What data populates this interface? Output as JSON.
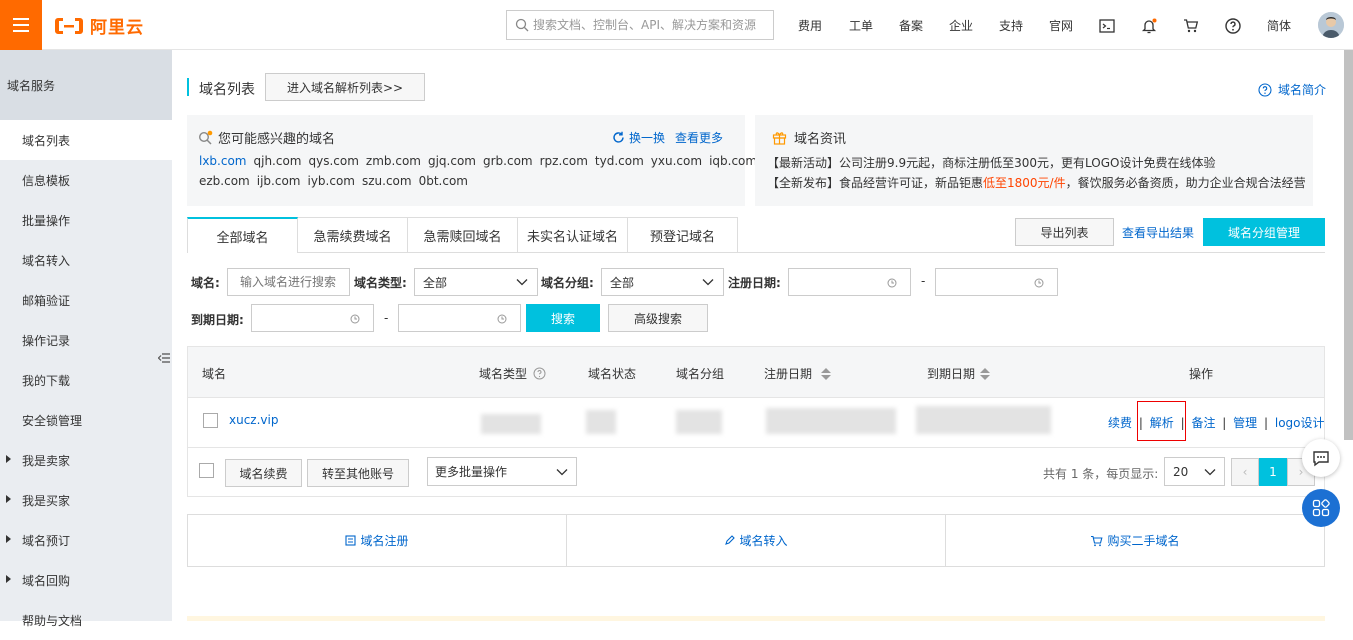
{
  "topbar": {
    "logo_text": "阿里云",
    "search_placeholder": "搜索文档、控制台、API、解决方案和资源",
    "nav": [
      "费用",
      "工单",
      "备案",
      "企业",
      "支持",
      "官网"
    ],
    "lang": "简体"
  },
  "sidebar": {
    "title": "域名服务",
    "items": [
      {
        "label": "域名列表"
      },
      {
        "label": "信息模板"
      },
      {
        "label": "批量操作"
      },
      {
        "label": "域名转入"
      },
      {
        "label": "邮箱验证"
      },
      {
        "label": "操作记录"
      },
      {
        "label": "我的下载"
      },
      {
        "label": "安全锁管理"
      },
      {
        "label": "我是卖家"
      },
      {
        "label": "我是买家"
      },
      {
        "label": "域名预订"
      },
      {
        "label": "域名回购"
      },
      {
        "label": "帮助与文档"
      }
    ]
  },
  "header": {
    "title": "域名列表",
    "enter_parse_list": "进入域名解析列表>>",
    "intro_link": "域名简介"
  },
  "interest": {
    "title": "您可能感兴趣的域名",
    "refresh": "换一换",
    "more": "查看更多",
    "row1": [
      "lxb.com",
      "qjh.com",
      "qys.com",
      "zmb.com",
      "gjq.com",
      "grb.com",
      "rpz.com",
      "tyd.com",
      "yxu.com",
      "iqb.com"
    ],
    "row2": [
      "ezb.com",
      "ijb.com",
      "iyb.com",
      "szu.com",
      "0bt.com"
    ]
  },
  "news": {
    "title": "域名资讯",
    "line1": "【最新活动】公司注册9.9元起，商标注册低至300元，更有LOGO设计免费在线体验",
    "line2_a": "【全新发布】食品经营许可证，新品钜惠",
    "line2_highlight": "低至1800元/件",
    "line2_b": "，餐饮服务必备资质，助力企业合规合法经营"
  },
  "tabs": [
    "全部域名",
    "急需续费域名",
    "急需赎回域名",
    "未实名认证域名",
    "预登记域名"
  ],
  "actions": {
    "export_list": "导出列表",
    "view_export": "查看导出结果",
    "group_manage": "域名分组管理"
  },
  "filters": {
    "domain_label": "域名:",
    "domain_placeholder": "输入域名进行搜索",
    "type_label": "域名类型:",
    "type_value": "全部",
    "group_label": "域名分组:",
    "group_value": "全部",
    "reg_date_label": "注册日期:",
    "expire_date_label": "到期日期:",
    "dash": "-",
    "search_btn": "搜索",
    "advanced_btn": "高级搜索"
  },
  "table": {
    "columns": [
      "域名",
      "域名类型",
      "域名状态",
      "域名分组",
      "注册日期",
      "到期日期",
      "操作"
    ],
    "rows": [
      {
        "domain": "xucz.vip",
        "ops": [
          "续费",
          "解析",
          "备注",
          "管理",
          "logo设计"
        ]
      }
    ],
    "sep": "|"
  },
  "footer": {
    "renew_btn": "域名续费",
    "transfer_btn": "转至其他账号",
    "batch_select": "更多批量操作",
    "summary": "共有 1 条，每页显示:",
    "page_size": "20",
    "current_page": "1",
    "prev": "‹",
    "next": "›"
  },
  "quick": [
    "域名注册",
    "域名转入",
    "购买二手域名"
  ],
  "colors": {
    "brand": "#ff6a00",
    "accent": "#00c1de",
    "link": "#0066cc",
    "highlight": "#ff4400"
  }
}
